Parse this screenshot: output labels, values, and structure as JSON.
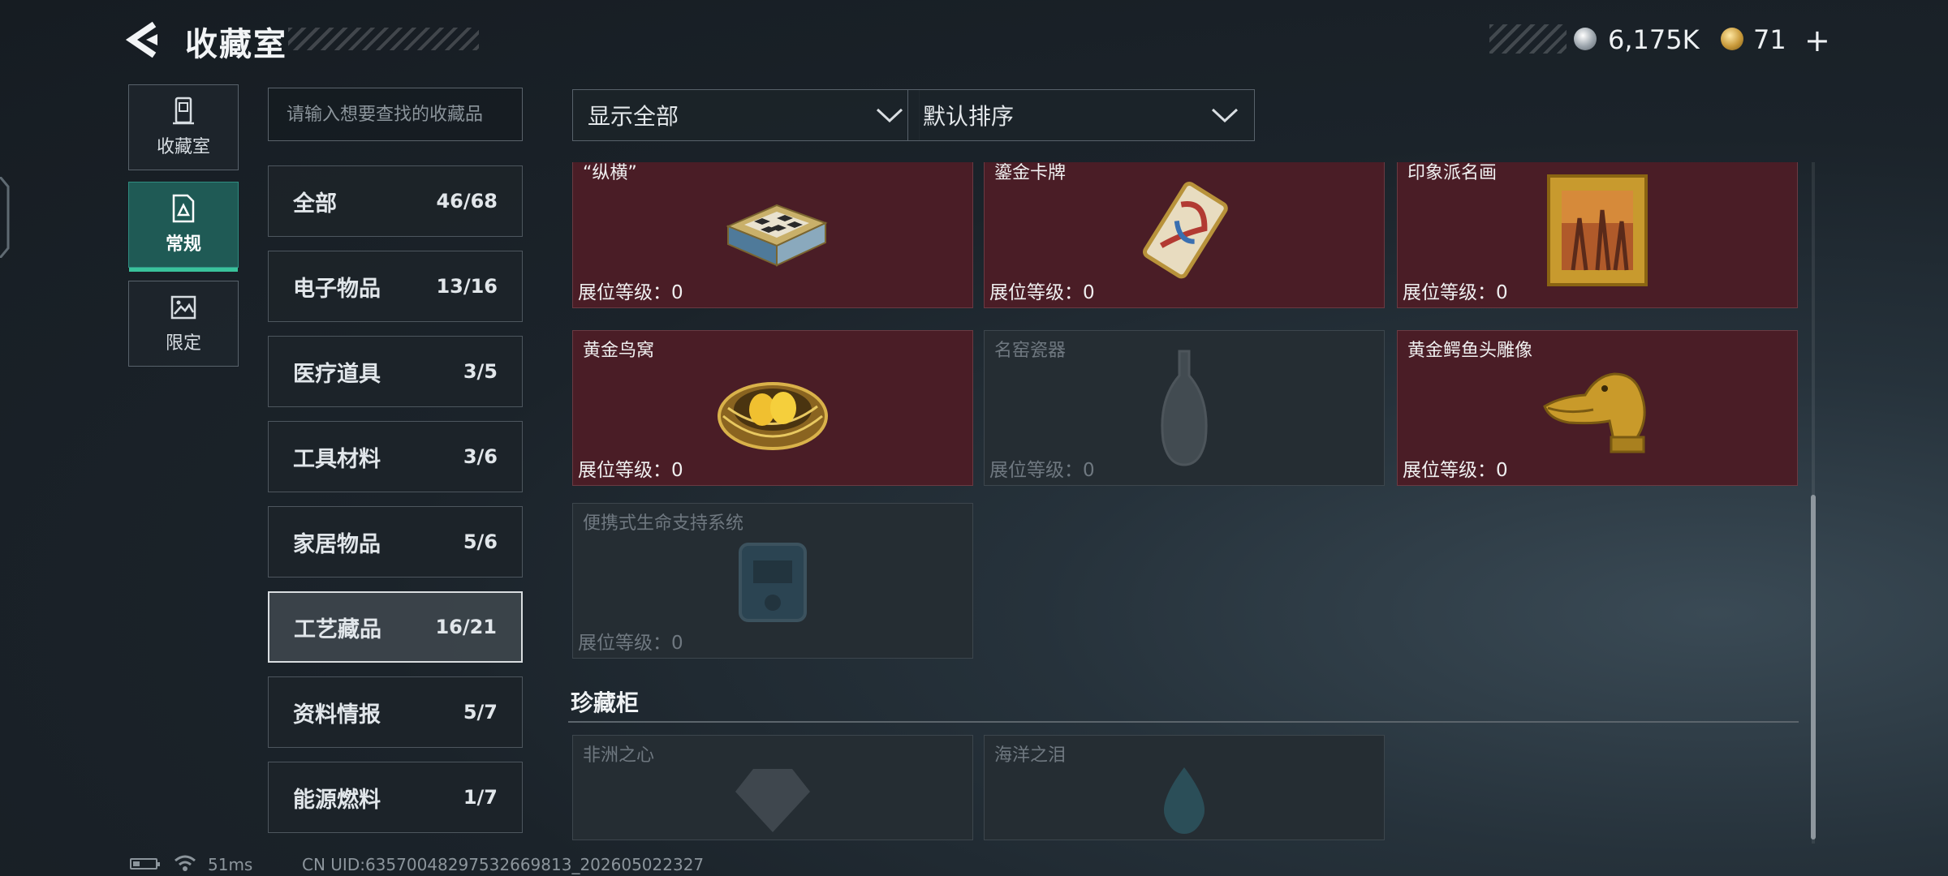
{
  "header": {
    "title": "收藏室",
    "silver_amount": "6,175K",
    "gold_amount": "71",
    "plus_symbol": "+"
  },
  "side_tabs": [
    {
      "label": "收藏室",
      "icon": "collection-room-icon",
      "active": false
    },
    {
      "label": "常规",
      "icon": "regular-document-icon",
      "active": true
    },
    {
      "label": "限定",
      "icon": "limited-image-icon",
      "active": false
    }
  ],
  "search": {
    "placeholder": "请输入想要查找的收藏品"
  },
  "categories": [
    {
      "name": "全部",
      "count": "46/68"
    },
    {
      "name": "电子物品",
      "count": "13/16"
    },
    {
      "name": "医疗道具",
      "count": "3/5"
    },
    {
      "name": "工具材料",
      "count": "3/6"
    },
    {
      "name": "家居物品",
      "count": "5/6"
    },
    {
      "name": "工艺藏品",
      "count": "16/21",
      "active": true
    },
    {
      "name": "资料情报",
      "count": "5/7"
    },
    {
      "name": "能源燃料",
      "count": "1/7"
    }
  ],
  "filters": {
    "display": "显示全部",
    "sort": "默认排序"
  },
  "items": [
    {
      "name": "“纵横”",
      "level": "展位等级：0",
      "owned": true,
      "icon": "chess-box-icon"
    },
    {
      "name": "鎏金卡牌",
      "level": "展位等级：0",
      "owned": true,
      "icon": "gilded-card-icon"
    },
    {
      "name": "印象派名画",
      "level": "展位等级：0",
      "owned": true,
      "icon": "framed-painting-icon"
    },
    {
      "name": "黄金鸟窝",
      "level": "展位等级：0",
      "owned": true,
      "icon": "golden-nest-icon"
    },
    {
      "name": "名窑瓷器",
      "level": "展位等级：0",
      "owned": false,
      "icon": "porcelain-vase-icon"
    },
    {
      "name": "黄金鳄鱼头雕像",
      "level": "展位等级：0",
      "owned": true,
      "icon": "gold-crocodile-statue-icon"
    },
    {
      "name": "便携式生命支持系统",
      "level": "展位等级：0",
      "owned": false,
      "icon": "life-support-icon"
    }
  ],
  "treasure_section": {
    "title": "珍藏柜",
    "items": [
      {
        "name": "非洲之心",
        "owned": false,
        "icon": "heart-of-africa-icon"
      },
      {
        "name": "海洋之泪",
        "owned": false,
        "icon": "ocean-tear-icon"
      }
    ]
  },
  "status": {
    "ping": "51ms",
    "uid": "CN UID:6357004829753266981​3_202605022327"
  },
  "colors": {
    "owned_card": "#4a1d26",
    "locked_card": "#252d33",
    "active_tab": "#1f5a55",
    "active_accent": "#39c29b"
  }
}
